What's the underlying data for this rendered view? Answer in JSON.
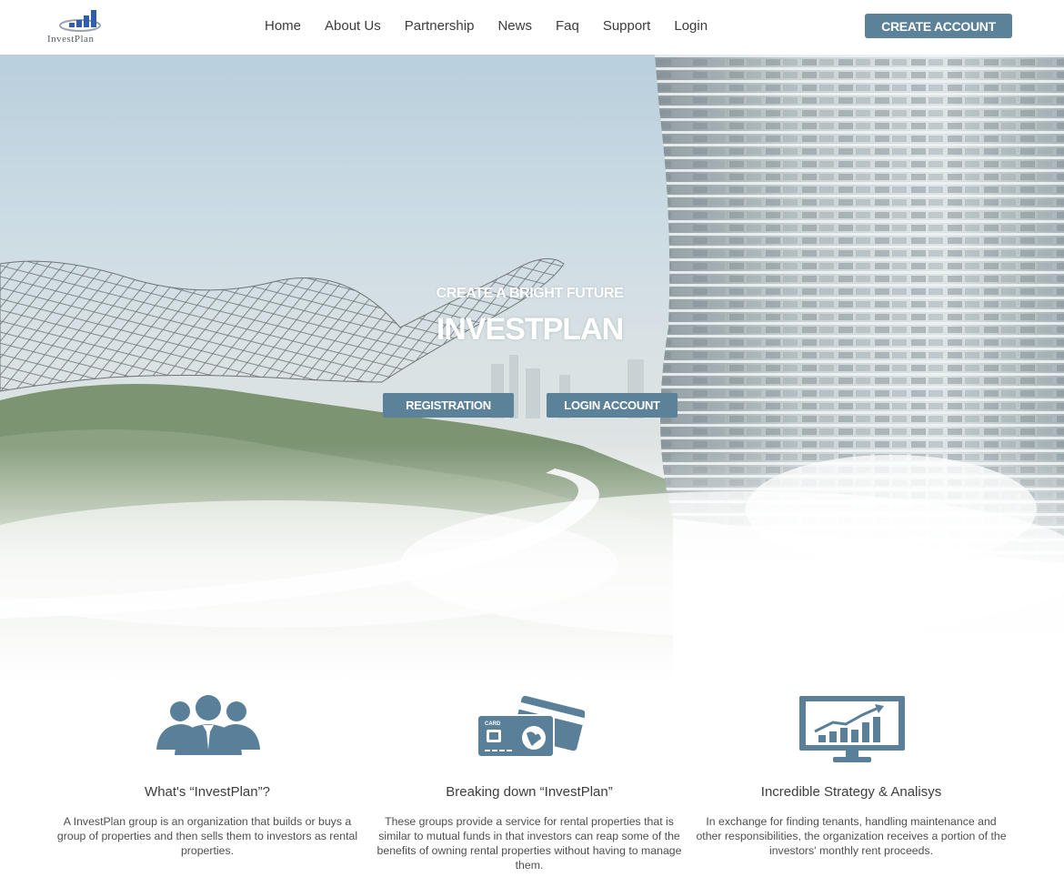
{
  "header": {
    "logo_text": "InvestPlan",
    "nav": [
      "Home",
      "About Us",
      "Partnership",
      "News",
      "Faq",
      "Support",
      "Login"
    ],
    "cta_label": "CREATE ACCOUNT"
  },
  "hero": {
    "tagline": "CREATE A BRIGHT FUTURE",
    "title": "INVESTPLAN",
    "registration_label": "REGISTRATION",
    "login_label": "LOGIN ACCOUNT"
  },
  "features": [
    {
      "icon": "team-icon",
      "title": "What's “InvestPlan”?",
      "text": "A InvestPlan group is an organization that builds or buys a group of properties and then sells them to investors as rental properties."
    },
    {
      "icon": "credit-card-icon",
      "title": "Breaking down “InvestPlan”",
      "text": "These groups provide a service for rental properties that is similar to mutual funds in that investors can reap some of the benefits of owning rental properties without having to manage them."
    },
    {
      "icon": "chart-monitor-icon",
      "title": "Incredible Strategy & Analisys",
      "text": "In exchange for finding tenants, handling maintenance and other responsibilities, the organization receives a portion of the investors' monthly rent proceeds."
    }
  ],
  "colors": {
    "accent": "#5b8299",
    "icon": "#5a8099",
    "text": "#3d3d3d"
  }
}
